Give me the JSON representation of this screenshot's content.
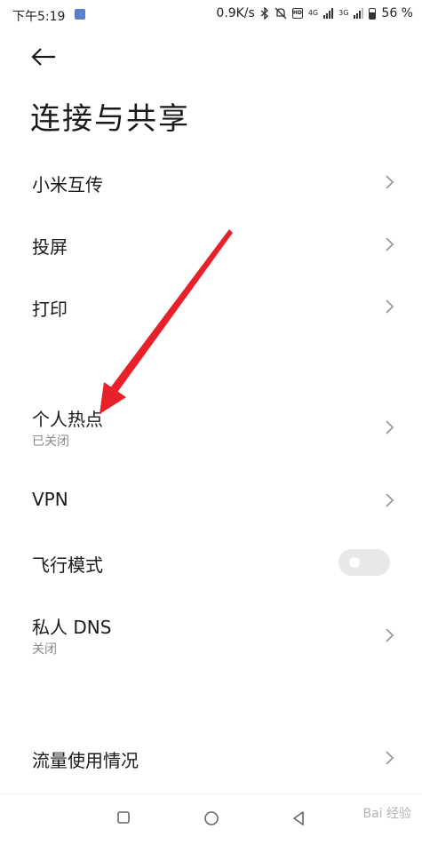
{
  "status_bar": {
    "time": "下午5:19",
    "speed": "0.9K/s",
    "signal1": "4G",
    "signal2": "3G",
    "battery": "56 %"
  },
  "header": {
    "title": "连接与共享"
  },
  "rows": {
    "mi_share": {
      "label": "小米互传"
    },
    "cast": {
      "label": "投屏"
    },
    "print": {
      "label": "打印"
    },
    "hotspot": {
      "label": "个人热点",
      "sub": "已关闭"
    },
    "vpn": {
      "label": "VPN"
    },
    "airplane": {
      "label": "飞行模式",
      "on": false
    },
    "private_dns": {
      "label": "私人 DNS",
      "sub": "关闭"
    },
    "data_usage": {
      "label": "流量使用情况"
    }
  },
  "watermark": "Bai 经验",
  "colors": {
    "arrow": "#e8202a",
    "toggle_off": "#e8e8e8",
    "sub_text": "#8a8a8a"
  }
}
